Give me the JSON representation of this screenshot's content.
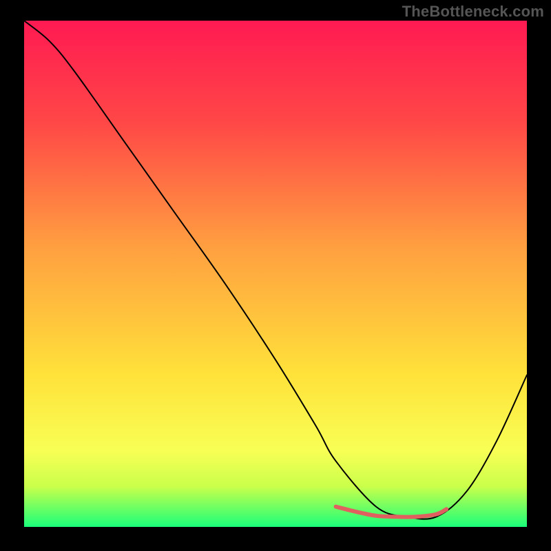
{
  "watermark": "TheBottleneck.com",
  "chart_data": {
    "type": "line",
    "title": "",
    "xlabel": "",
    "ylabel": "",
    "xlim": [
      0,
      100
    ],
    "ylim": [
      0,
      100
    ],
    "grid": false,
    "legend": false,
    "background": {
      "type": "vertical-gradient",
      "stops": [
        {
          "pos": 0.0,
          "color": "#ff1a52"
        },
        {
          "pos": 0.2,
          "color": "#ff4747"
        },
        {
          "pos": 0.45,
          "color": "#ffa040"
        },
        {
          "pos": 0.7,
          "color": "#ffe23a"
        },
        {
          "pos": 0.85,
          "color": "#f8ff55"
        },
        {
          "pos": 0.92,
          "color": "#caff4a"
        },
        {
          "pos": 1.0,
          "color": "#1aff7a"
        }
      ]
    },
    "series": [
      {
        "name": "bottleneck-curve",
        "color": "#000000",
        "width": 2,
        "x": [
          0,
          5,
          10,
          20,
          30,
          40,
          50,
          58,
          62,
          70,
          76,
          82,
          88,
          94,
          100
        ],
        "y": [
          100,
          96,
          90,
          76,
          62,
          48,
          33,
          20,
          13,
          4,
          2,
          2,
          7,
          17,
          30
        ]
      },
      {
        "name": "optimal-zone",
        "color": "#e06060",
        "width": 6,
        "x": [
          62,
          66,
          70,
          74,
          78,
          82,
          84
        ],
        "y": [
          4,
          3,
          2.2,
          2,
          2,
          2.5,
          3.5
        ]
      }
    ]
  }
}
